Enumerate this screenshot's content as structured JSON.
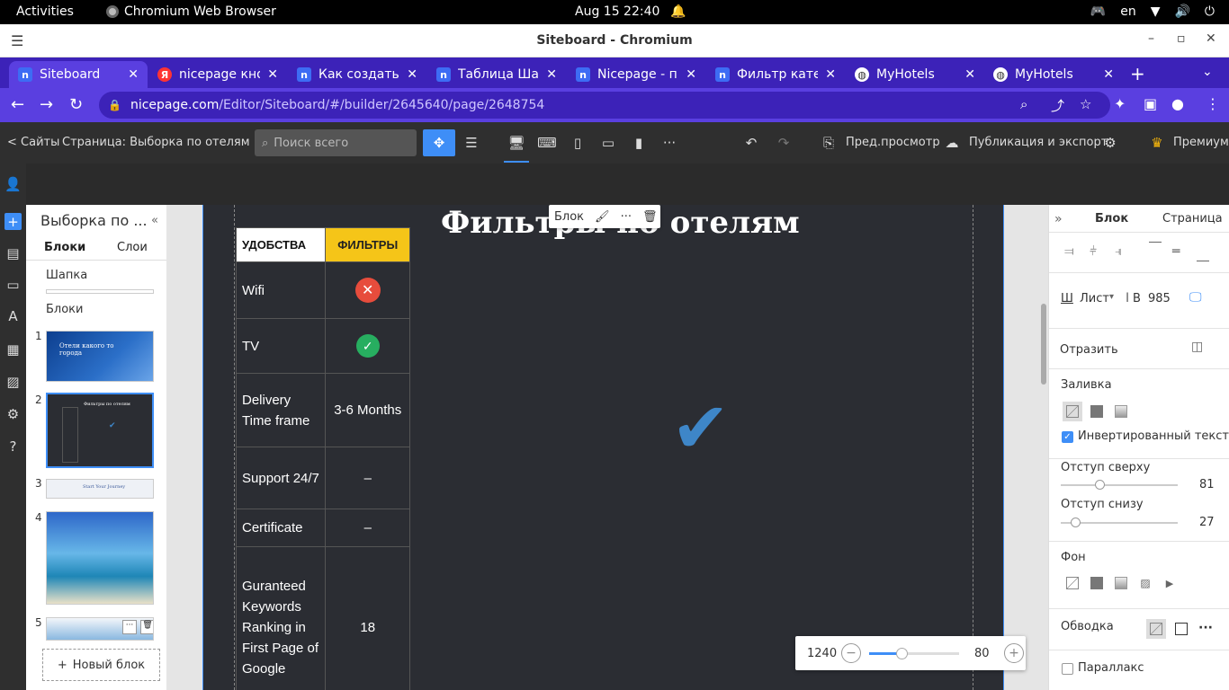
{
  "os_bar": {
    "activities": "Activities",
    "app_name": "Chromium Web Browser",
    "clock": "Aug 15  22:40",
    "language": "en"
  },
  "window": {
    "title": "Siteboard - Chromium"
  },
  "tabs": [
    {
      "label": "Siteboard",
      "icon": "n"
    },
    {
      "label": "nicepage кно",
      "icon": "y"
    },
    {
      "label": "Как создать",
      "icon": "n"
    },
    {
      "label": "Таблица Шаб",
      "icon": "n"
    },
    {
      "label": "Nicepage - пр",
      "icon": "n"
    },
    {
      "label": "Фильтр кате",
      "icon": "n"
    },
    {
      "label": "MyHotels",
      "icon": "g"
    },
    {
      "label": "MyHotels",
      "icon": "g"
    }
  ],
  "address": {
    "host": "nicepage.com",
    "path": "/Editor/Siteboard/#/builder/2645640/page/2648754"
  },
  "editor_toolbar": {
    "back_label": "< Сайты",
    "page_label": "Страница: Выборка по отелям",
    "search_placeholder": "Поиск всего",
    "preview_label": "Пред.просмотр",
    "publish_label": "Публикация и экспорт",
    "premium_label": "Премиум"
  },
  "left_panel": {
    "title": "Выборка по ...",
    "tab_blocks": "Блоки",
    "tab_layers": "Слои",
    "section_header": "Шапка",
    "section_blocks": "Блоки",
    "block_numbers": [
      "1",
      "2",
      "3",
      "4",
      "5"
    ],
    "thumb1_text": "Отели какого то города",
    "thumb2_text": "Фильтры по отелям",
    "thumb3_text": "Start Your Journey",
    "new_block_label": "Новый блок"
  },
  "canvas": {
    "heading": "Фильтры по отелям",
    "block_tip_label": "Блок",
    "table": {
      "headers": [
        "УДОБСТВА",
        "ФИЛЬТРЫ"
      ],
      "rows": [
        {
          "feature": "Wifi",
          "value": "",
          "icon": "x-icon"
        },
        {
          "feature": "TV",
          "value": "",
          "icon": "check-icon"
        },
        {
          "feature": "Delivery Time frame",
          "value": "3-6 Months"
        },
        {
          "feature": "Support 24/7",
          "value": "–"
        },
        {
          "feature": "Certificate",
          "value": "–"
        },
        {
          "feature": "Guranteed Keywords Ranking in First Page of Google",
          "value": "18"
        }
      ]
    }
  },
  "zoom": {
    "width_value": "1240",
    "zoom_value": "80",
    "zoom_fraction": 0.36
  },
  "right_panel": {
    "tab_block": "Блок",
    "tab_page": "Страница",
    "width_label": "Ш",
    "sheet_label": "Лист",
    "height_label": "В",
    "height_value": "985",
    "mirror_label": "Отразить",
    "fill_label": "Заливка",
    "inverted_text_label": "Инвертированный текст",
    "inverted_text_checked": true,
    "padding_top_label": "Отступ сверху",
    "padding_top_value": "81",
    "padding_bottom_label": "Отступ снизу",
    "padding_bottom_value": "27",
    "background_label": "Фон",
    "border_label": "Обводка",
    "parallax_label": "Параллакс",
    "parallax_checked": false
  },
  "colors": {
    "accent": "#3e8ef7",
    "tabstrip": "#3c22b8",
    "header_yellow": "#f5c518",
    "page_bg": "#2b2d33",
    "x_red": "#e74c3c",
    "ok_green": "#27ae60",
    "check_blue": "#3e86c8"
  }
}
